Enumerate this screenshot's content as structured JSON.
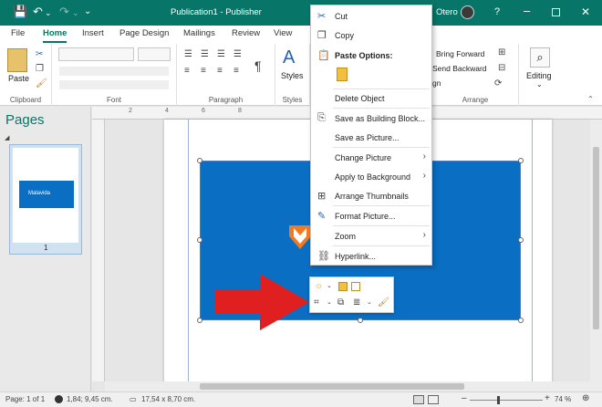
{
  "titlebar": {
    "title": "Publication1 - Publisher",
    "user": "Otero"
  },
  "tabs": [
    "File",
    "Home",
    "Insert",
    "Page Design",
    "Mailings",
    "Review",
    "View"
  ],
  "ribbon": {
    "paste": "Paste",
    "clipboard": "Clipboard",
    "font": "Font",
    "paragraph": "Paragraph",
    "styles": "Styles",
    "arrange": "Arrange",
    "editing": "Editing",
    "bring_forward": "Bring Forward",
    "send_backward": "Send Backward",
    "align": "Align"
  },
  "pages_title": "Pages",
  "thumb_num": "1",
  "thumb_logo": "Malavida",
  "context_menu": [
    {
      "label": "Cut",
      "icon": "scissors-icon"
    },
    {
      "label": "Copy",
      "icon": "copy-icon"
    },
    {
      "label": "Paste Options:",
      "icon": "paste-icon",
      "bold": true
    },
    {
      "label": "",
      "icon": "paste-option-icon"
    },
    {
      "label": "Delete Object",
      "icon": ""
    },
    {
      "label": "Save as Building Block...",
      "icon": "building-block-icon"
    },
    {
      "label": "Save as Picture...",
      "icon": ""
    },
    {
      "label": "Change Picture",
      "icon": "",
      "submenu": true
    },
    {
      "label": "Apply to Background",
      "icon": "",
      "submenu": true
    },
    {
      "label": "Arrange Thumbnails",
      "icon": "thumbnails-icon"
    },
    {
      "label": "Format Picture...",
      "icon": "format-picture-icon"
    },
    {
      "label": "Zoom",
      "icon": "",
      "submenu": true
    },
    {
      "label": "Hyperlink...",
      "icon": "link-icon"
    }
  ],
  "status": {
    "page": "Page: 1 of 1",
    "pos": "1,84; 9,45 cm.",
    "size": "17,54 x 8,70 cm.",
    "zoom": "74 %"
  },
  "colors": {
    "accent": "#077568",
    "image_bg": "#0a6ec2",
    "arrow": "#e02020"
  }
}
